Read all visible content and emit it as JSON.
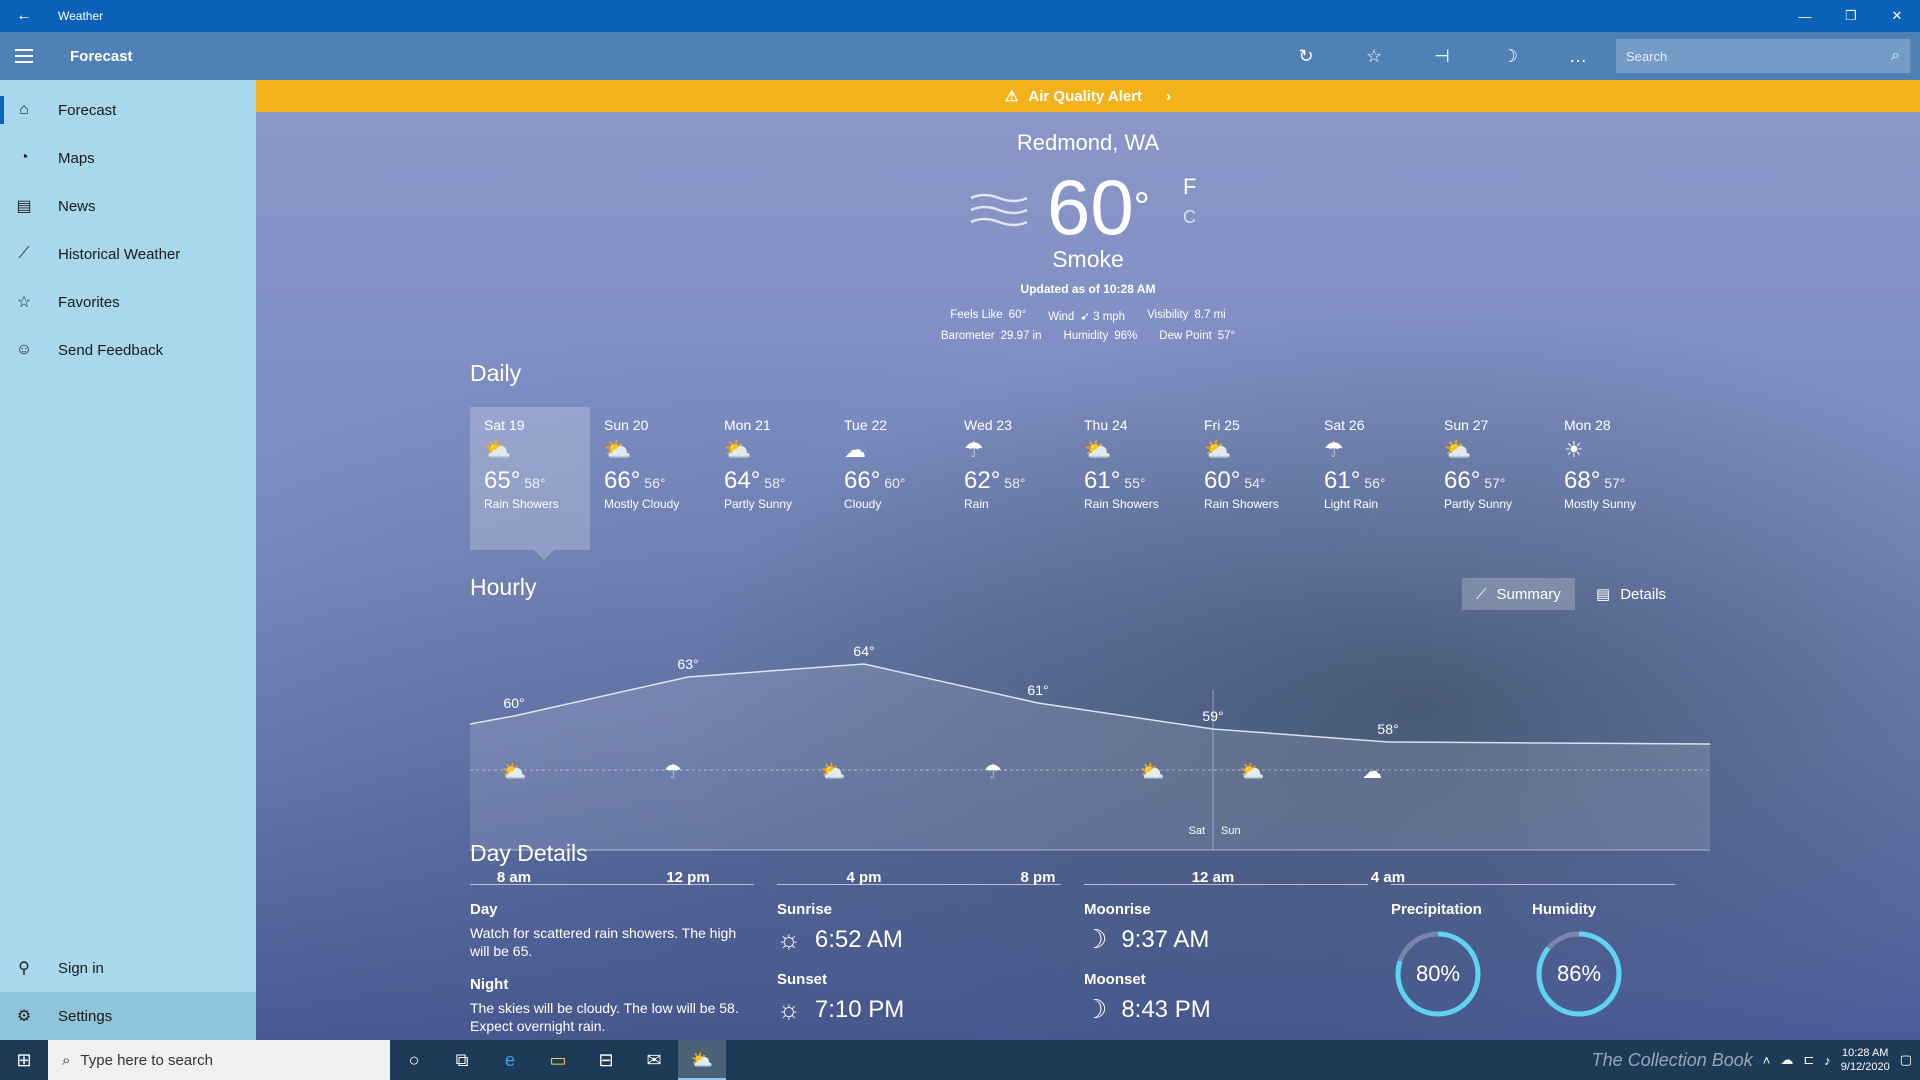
{
  "window": {
    "title": "Weather",
    "back_icon": "back-arrow-icon"
  },
  "header": {
    "page_title": "Forecast",
    "search_placeholder": "Search",
    "actions": [
      "refresh-icon",
      "favorite-star-icon",
      "pin-icon",
      "night-mode-moon-icon",
      "more-icon"
    ]
  },
  "sidebar": {
    "items": [
      {
        "label": "Forecast",
        "icon": "home-icon"
      },
      {
        "label": "Maps",
        "icon": "radar-icon"
      },
      {
        "label": "News",
        "icon": "news-icon"
      },
      {
        "label": "Historical Weather",
        "icon": "chart-icon"
      },
      {
        "label": "Favorites",
        "icon": "favorites-list-icon"
      },
      {
        "label": "Send Feedback",
        "icon": "smiley-icon"
      }
    ],
    "bottom": [
      {
        "label": "Sign in",
        "icon": "person-icon"
      },
      {
        "label": "Settings",
        "icon": "gear-icon"
      }
    ]
  },
  "alert": {
    "text": "Air Quality Alert"
  },
  "current": {
    "location": "Redmond, WA",
    "temperature": "60",
    "degree": "°",
    "unit_f": "F",
    "unit_c": "C",
    "condition": "Smoke",
    "updated": "Updated as of 10:28 AM",
    "stats_row1": [
      {
        "label": "Feels Like",
        "value": "60°"
      },
      {
        "label": "Wind",
        "value": "3 mph"
      },
      {
        "label": "Visibility",
        "value": "8.7 mi"
      }
    ],
    "stats_row2": [
      {
        "label": "Barometer",
        "value": "29.97 in"
      },
      {
        "label": "Humidity",
        "value": "96%"
      },
      {
        "label": "Dew Point",
        "value": "57°"
      }
    ]
  },
  "daily": {
    "title": "Daily",
    "days": [
      {
        "name": "Sat 19",
        "hi": "65°",
        "lo": "58°",
        "cond": "Rain Showers",
        "icon": "sun-cloud-rain-icon"
      },
      {
        "name": "Sun 20",
        "hi": "66°",
        "lo": "56°",
        "cond": "Mostly Cloudy",
        "icon": "mostly-cloudy-icon"
      },
      {
        "name": "Mon 21",
        "hi": "64°",
        "lo": "58°",
        "cond": "Partly Sunny",
        "icon": "partly-sunny-icon"
      },
      {
        "name": "Tue 22",
        "hi": "66°",
        "lo": "60°",
        "cond": "Cloudy",
        "icon": "cloud-icon"
      },
      {
        "name": "Wed 23",
        "hi": "62°",
        "lo": "58°",
        "cond": "Rain",
        "icon": "rain-icon"
      },
      {
        "name": "Thu 24",
        "hi": "61°",
        "lo": "55°",
        "cond": "Rain Showers",
        "icon": "sun-cloud-rain-icon"
      },
      {
        "name": "Fri 25",
        "hi": "60°",
        "lo": "54°",
        "cond": "Rain Showers",
        "icon": "sun-cloud-rain-icon"
      },
      {
        "name": "Sat 26",
        "hi": "61°",
        "lo": "56°",
        "cond": "Light Rain",
        "icon": "light-rain-icon"
      },
      {
        "name": "Sun 27",
        "hi": "66°",
        "lo": "57°",
        "cond": "Partly Sunny",
        "icon": "partly-sunny-icon"
      },
      {
        "name": "Mon 28",
        "hi": "68°",
        "lo": "57°",
        "cond": "Mostly Sunny",
        "icon": "sun-icon"
      }
    ]
  },
  "hourly": {
    "title": "Hourly",
    "summary_label": "Summary",
    "details_label": "Details",
    "temp_labels": [
      "60°",
      "63°",
      "64°",
      "61°",
      "59°",
      "58°"
    ],
    "time_labels": [
      "8 am",
      "12 pm",
      "4 pm",
      "8 pm",
      "12 am",
      "4 am"
    ],
    "day_split": [
      "Sat",
      "Sun"
    ]
  },
  "chart_data": {
    "type": "line",
    "x": [
      "8 am",
      "12 pm",
      "4 pm",
      "8 pm",
      "12 am",
      "4 am"
    ],
    "series": [
      {
        "values": [
          60,
          63,
          64,
          61,
          59,
          58
        ]
      }
    ],
    "icons": [
      "sun-cloud-rain-icon",
      "rain-icon",
      "sun-cloud-rain-icon",
      "rain-icon",
      "sun-cloud-rain-icon",
      "partly-cloudy-icon",
      "cloud-icon"
    ]
  },
  "day_details": {
    "title": "Day Details",
    "day_heading": "Day",
    "day_text": "Watch for scattered rain showers. The high will be 65.",
    "night_heading": "Night",
    "night_text": "The skies will be cloudy. The low will be 58. Expect overnight rain.",
    "sunrise_label": "Sunrise",
    "sunrise": "6:52 AM",
    "sunset_label": "Sunset",
    "sunset": "7:10 PM",
    "moonrise_label": "Moonrise",
    "moonrise": "9:37 AM",
    "moonset_label": "Moonset",
    "moonset": "8:43 PM",
    "precip_label": "Precipitation",
    "precip": "80%",
    "precip_value": 0.8,
    "humidity_label": "Humidity",
    "humidity": "86%",
    "humidity_value": 0.86,
    "gauge_color": "#5fd3f0"
  },
  "taskbar": {
    "search_placeholder": "Type here to search",
    "time": "10:28 AM",
    "date": "9/12/2020",
    "watermark": "The Collection Book"
  }
}
